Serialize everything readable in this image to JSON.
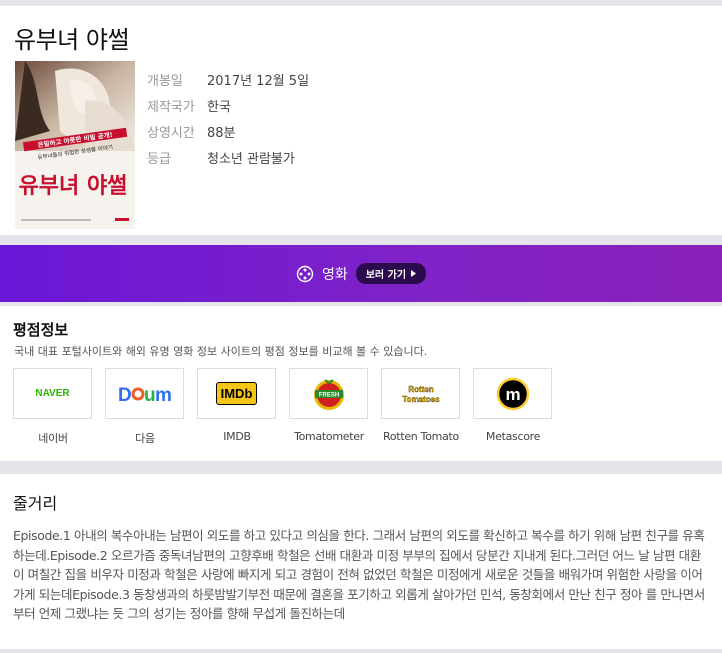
{
  "movie": {
    "title": "유부녀 야썰",
    "poster": {
      "headline": "은밀하고 야릇한 비밀 공개!",
      "subline": "유부녀들의 위험한 성생활 이야기",
      "logo": "유부녀 야썰",
      "colors": {
        "accent": "#c8102e"
      }
    },
    "info": [
      {
        "key": "개봉일",
        "value": "2017년 12월 5일"
      },
      {
        "key": "제작국가",
        "value": "한국"
      },
      {
        "key": "상영시간",
        "value": "88분"
      },
      {
        "key": "등급",
        "value": "청소년 관람불가"
      }
    ]
  },
  "banner": {
    "label": "영화",
    "button": "보러 가기",
    "icon": "film-reel-icon",
    "colors": {
      "from": "#6a16d6",
      "to": "#8a20b8"
    }
  },
  "ratings": {
    "title": "평점정보",
    "description": "국내 대표 포털사이트와 해외 유명 영화 정보 사이트의 평점 정보를 비교해 볼 수 있습니다.",
    "sites": [
      {
        "name": "네이버",
        "logo_text": "NAVER",
        "icon": "naver-logo"
      },
      {
        "name": "다음",
        "logo_text": "Daum",
        "icon": "daum-logo"
      },
      {
        "name": "IMDB",
        "logo_text": "IMDb",
        "icon": "imdb-logo"
      },
      {
        "name": "Tomatometer",
        "logo_text": "FRESH",
        "icon": "tomatometer-logo"
      },
      {
        "name": "Rotten Tomato",
        "logo_text": "Rotten Tomatoes",
        "icon": "rotten-tomatoes-logo"
      },
      {
        "name": "Metascore",
        "logo_text": "m",
        "icon": "metacritic-logo"
      }
    ]
  },
  "plot": {
    "title": "줄거리",
    "text": "Episode.1 아내의 복수아내는 남편이 외도를 하고 있다고 의심을 한다. 그래서 남편의 외도를 확신하고 복수를 하기 위해 남편 친구를 유혹하는데.Episode.2 오르가즘 중독녀남편의 고향후배 학철은 선배 대환과 미정 부부의 집에서 당분간 지내게 된다.그러던 어느 날 남편 대환이 며칠간 집을 비우자 미정과 학철은 사랑에 빠지게 되고 경험이 전혀 없었던 학철은 미정에게 새로운 것들을 배워가며 위험한 사랑을 이어가게 되는데Episode.3 동창생과의 하룻밤발기부전 때문에 결혼을 포기하고 외롭게 살아가던 민석, 동창회에서 만난 친구 정아 를 만나면서 부터 언제 그랬냐는 듯 그의 성기는 정아를 향해 무섭게 돌진하는데"
  }
}
